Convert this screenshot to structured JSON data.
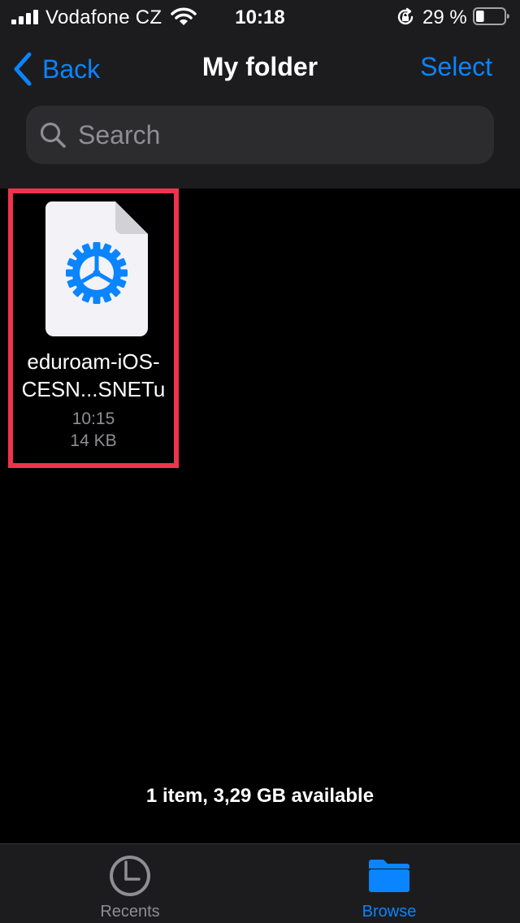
{
  "status_bar": {
    "carrier": "Vodafone CZ",
    "time": "10:18",
    "battery_percent": "29 %",
    "battery_level": 0.29,
    "icons": [
      "signal-icon",
      "wifi-icon",
      "rotation-lock-icon",
      "battery-icon"
    ]
  },
  "nav": {
    "back_label": "Back",
    "title": "My folder",
    "select_label": "Select"
  },
  "search": {
    "placeholder": "Search",
    "value": ""
  },
  "files": [
    {
      "name_line1": "eduroam-iOS-",
      "name_line2": "CESN...SNETu",
      "time": "10:15",
      "size": "14 KB",
      "icon": "settings-gear-icon",
      "selected": true
    }
  ],
  "footer": {
    "status": "1 item, 3,29 GB available"
  },
  "tabs": [
    {
      "label": "Recents",
      "icon": "clock-icon",
      "active": false
    },
    {
      "label": "Browse",
      "icon": "folder-icon",
      "active": true
    }
  ],
  "colors": {
    "accent": "#0a84ff",
    "selection_border": "#f0334b",
    "background": "#000000",
    "bar_background": "#1c1c1e"
  }
}
